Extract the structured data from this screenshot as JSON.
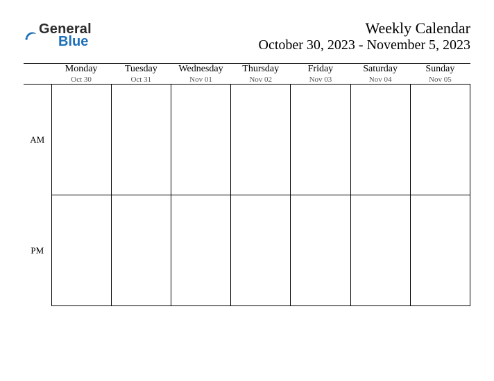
{
  "brand": {
    "word1": "General",
    "word2": "Blue"
  },
  "header": {
    "title": "Weekly Calendar",
    "date_range": "October 30, 2023 - November 5, 2023"
  },
  "periods": {
    "am": "AM",
    "pm": "PM"
  },
  "days": [
    {
      "dow": "Monday",
      "date": "Oct 30"
    },
    {
      "dow": "Tuesday",
      "date": "Oct 31"
    },
    {
      "dow": "Wednesday",
      "date": "Nov 01"
    },
    {
      "dow": "Thursday",
      "date": "Nov 02"
    },
    {
      "dow": "Friday",
      "date": "Nov 03"
    },
    {
      "dow": "Saturday",
      "date": "Nov 04"
    },
    {
      "dow": "Sunday",
      "date": "Nov 05"
    }
  ]
}
